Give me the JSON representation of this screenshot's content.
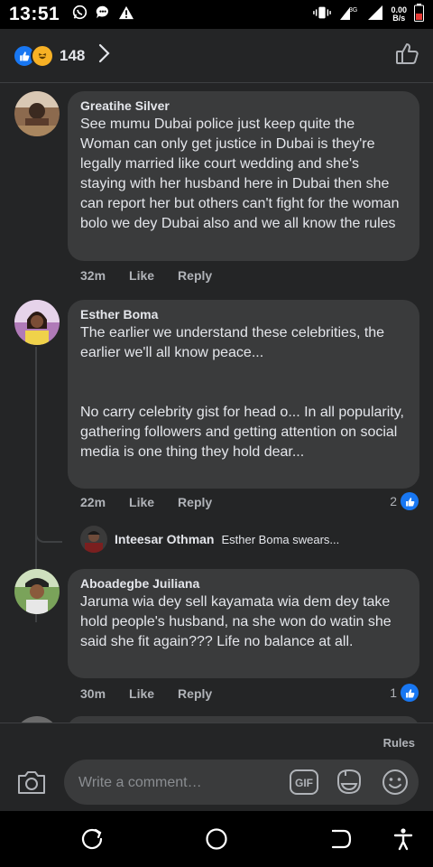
{
  "status_bar": {
    "time": "13:51",
    "net_speed_value": "0.00",
    "net_speed_unit": "B/s",
    "network_label": "3G"
  },
  "header": {
    "reaction_count": "148"
  },
  "comments": [
    {
      "author": "Greatihe Silver",
      "text": "See mumu Dubai police just keep quite the Woman can only get justice in Dubai is they're legally married like court wedding and she's staying with her husband here in Dubai then she can report her but others can't fight for the woman bolo we dey Dubai also and we all know the rules",
      "time": "32m",
      "like_label": "Like",
      "reply_label": "Reply"
    },
    {
      "author": "Esther Boma",
      "text": "The earlier we understand these celebrities, the earlier we'll all know peace...\n\n\nNo carry celebrity gist for head o... In all popularity, gathering followers and getting attention on social media is one thing they hold dear...",
      "time": "22m",
      "like_label": "Like",
      "reply_label": "Reply",
      "likes": "2",
      "reply_preview": {
        "author": "Inteesar Othman",
        "text": "Esther Boma swears..."
      }
    },
    {
      "author": "Aboadegbe Juiliana",
      "text": "Jaruma wia dey sell kayamata wia dem dey take hold people's husband, na she won do watin she said she fit again??? Life no balance at all.",
      "time": "30m",
      "like_label": "Like",
      "reply_label": "Reply",
      "likes": "1"
    }
  ],
  "composer": {
    "rules_label": "Rules",
    "placeholder": "Write a comment…",
    "gif_label": "GIF"
  },
  "colors": {
    "accent": "#1877f2",
    "bubble": "#3a3b3c",
    "background": "#242526"
  }
}
